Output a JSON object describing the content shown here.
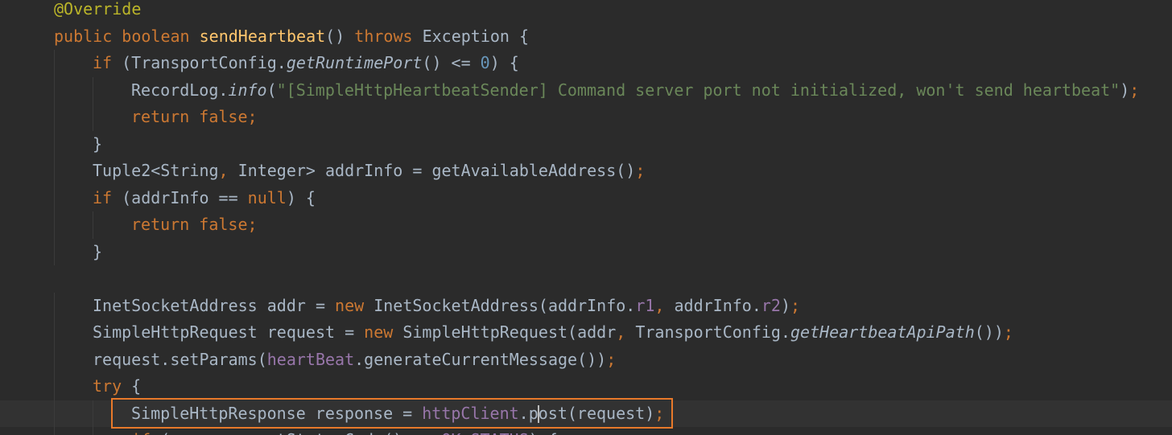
{
  "editor": {
    "caret_line": 15,
    "highlighted_line": 15,
    "lines": [
      {
        "indent": 0,
        "tokens": [
          {
            "t": "@Override",
            "c": "annotation"
          }
        ]
      },
      {
        "indent": 0,
        "tokens": [
          {
            "t": "public boolean ",
            "c": "keyword"
          },
          {
            "t": "sendHeartbeat",
            "c": "method-decl"
          },
          {
            "t": "() ",
            "c": "plain"
          },
          {
            "t": "throws ",
            "c": "keyword"
          },
          {
            "t": "Exception {",
            "c": "plain"
          }
        ]
      },
      {
        "indent": 1,
        "tokens": [
          {
            "t": "if ",
            "c": "keyword"
          },
          {
            "t": "(TransportConfig.",
            "c": "plain"
          },
          {
            "t": "getRuntimePort",
            "c": "static"
          },
          {
            "t": "() <= ",
            "c": "plain"
          },
          {
            "t": "0",
            "c": "number"
          },
          {
            "t": ") {",
            "c": "plain"
          }
        ]
      },
      {
        "indent": 2,
        "tokens": [
          {
            "t": "RecordLog.",
            "c": "plain"
          },
          {
            "t": "info",
            "c": "static"
          },
          {
            "t": "(",
            "c": "plain"
          },
          {
            "t": "\"[SimpleHttpHeartbeatSender] Command server port not initialized, won't send heartbeat\"",
            "c": "string"
          },
          {
            "t": ")",
            "c": "plain"
          },
          {
            "t": ";",
            "c": "punct"
          }
        ]
      },
      {
        "indent": 2,
        "tokens": [
          {
            "t": "return false;",
            "c": "keyword"
          }
        ]
      },
      {
        "indent": 1,
        "tokens": [
          {
            "t": "}",
            "c": "plain"
          }
        ]
      },
      {
        "indent": 1,
        "tokens": [
          {
            "t": "Tuple2<String",
            "c": "plain"
          },
          {
            "t": ", ",
            "c": "punct"
          },
          {
            "t": "Integer> addrInfo = getAvailableAddress()",
            "c": "plain"
          },
          {
            "t": ";",
            "c": "punct"
          }
        ]
      },
      {
        "indent": 1,
        "tokens": [
          {
            "t": "if ",
            "c": "keyword"
          },
          {
            "t": "(addrInfo == ",
            "c": "plain"
          },
          {
            "t": "null",
            "c": "keyword"
          },
          {
            "t": ") {",
            "c": "plain"
          }
        ]
      },
      {
        "indent": 2,
        "tokens": [
          {
            "t": "return false;",
            "c": "keyword"
          }
        ]
      },
      {
        "indent": 1,
        "tokens": [
          {
            "t": "}",
            "c": "plain"
          }
        ]
      },
      {
        "indent": 0,
        "tokens": []
      },
      {
        "indent": 1,
        "tokens": [
          {
            "t": "InetSocketAddress addr = ",
            "c": "plain"
          },
          {
            "t": "new ",
            "c": "keyword"
          },
          {
            "t": "InetSocketAddress(addrInfo.",
            "c": "plain"
          },
          {
            "t": "r1",
            "c": "field"
          },
          {
            "t": ", ",
            "c": "punct"
          },
          {
            "t": "addrInfo.",
            "c": "plain"
          },
          {
            "t": "r2",
            "c": "field"
          },
          {
            "t": ")",
            "c": "plain"
          },
          {
            "t": ";",
            "c": "punct"
          }
        ]
      },
      {
        "indent": 1,
        "tokens": [
          {
            "t": "SimpleHttpRequest request = ",
            "c": "plain"
          },
          {
            "t": "new ",
            "c": "keyword"
          },
          {
            "t": "SimpleHttpRequest(addr",
            "c": "plain"
          },
          {
            "t": ", ",
            "c": "punct"
          },
          {
            "t": "TransportConfig.",
            "c": "plain"
          },
          {
            "t": "getHeartbeatApiPath",
            "c": "static"
          },
          {
            "t": "())",
            "c": "plain"
          },
          {
            "t": ";",
            "c": "punct"
          }
        ]
      },
      {
        "indent": 1,
        "tokens": [
          {
            "t": "request.setParams(",
            "c": "plain"
          },
          {
            "t": "heartBeat",
            "c": "field"
          },
          {
            "t": ".generateCurrentMessage())",
            "c": "plain"
          },
          {
            "t": ";",
            "c": "punct"
          }
        ]
      },
      {
        "indent": 1,
        "tokens": [
          {
            "t": "try ",
            "c": "keyword"
          },
          {
            "t": "{",
            "c": "plain"
          }
        ]
      },
      {
        "indent": 2,
        "tokens": [
          {
            "t": "SimpleHttpResponse response = ",
            "c": "plain"
          },
          {
            "t": "httpClient",
            "c": "field"
          },
          {
            "t": ".p",
            "c": "plain"
          },
          {
            "t": "|",
            "c": "caret"
          },
          {
            "t": "ost(request)",
            "c": "plain"
          },
          {
            "t": ";",
            "c": "punct"
          }
        ]
      },
      {
        "indent": 2,
        "tokens": [
          {
            "t": "if ",
            "c": "keyword"
          },
          {
            "t": "(response.getStatusCode() == ",
            "c": "plain"
          },
          {
            "t": "OK_STATUS",
            "c": "field"
          },
          {
            "t": ") {",
            "c": "plain"
          }
        ]
      }
    ]
  }
}
